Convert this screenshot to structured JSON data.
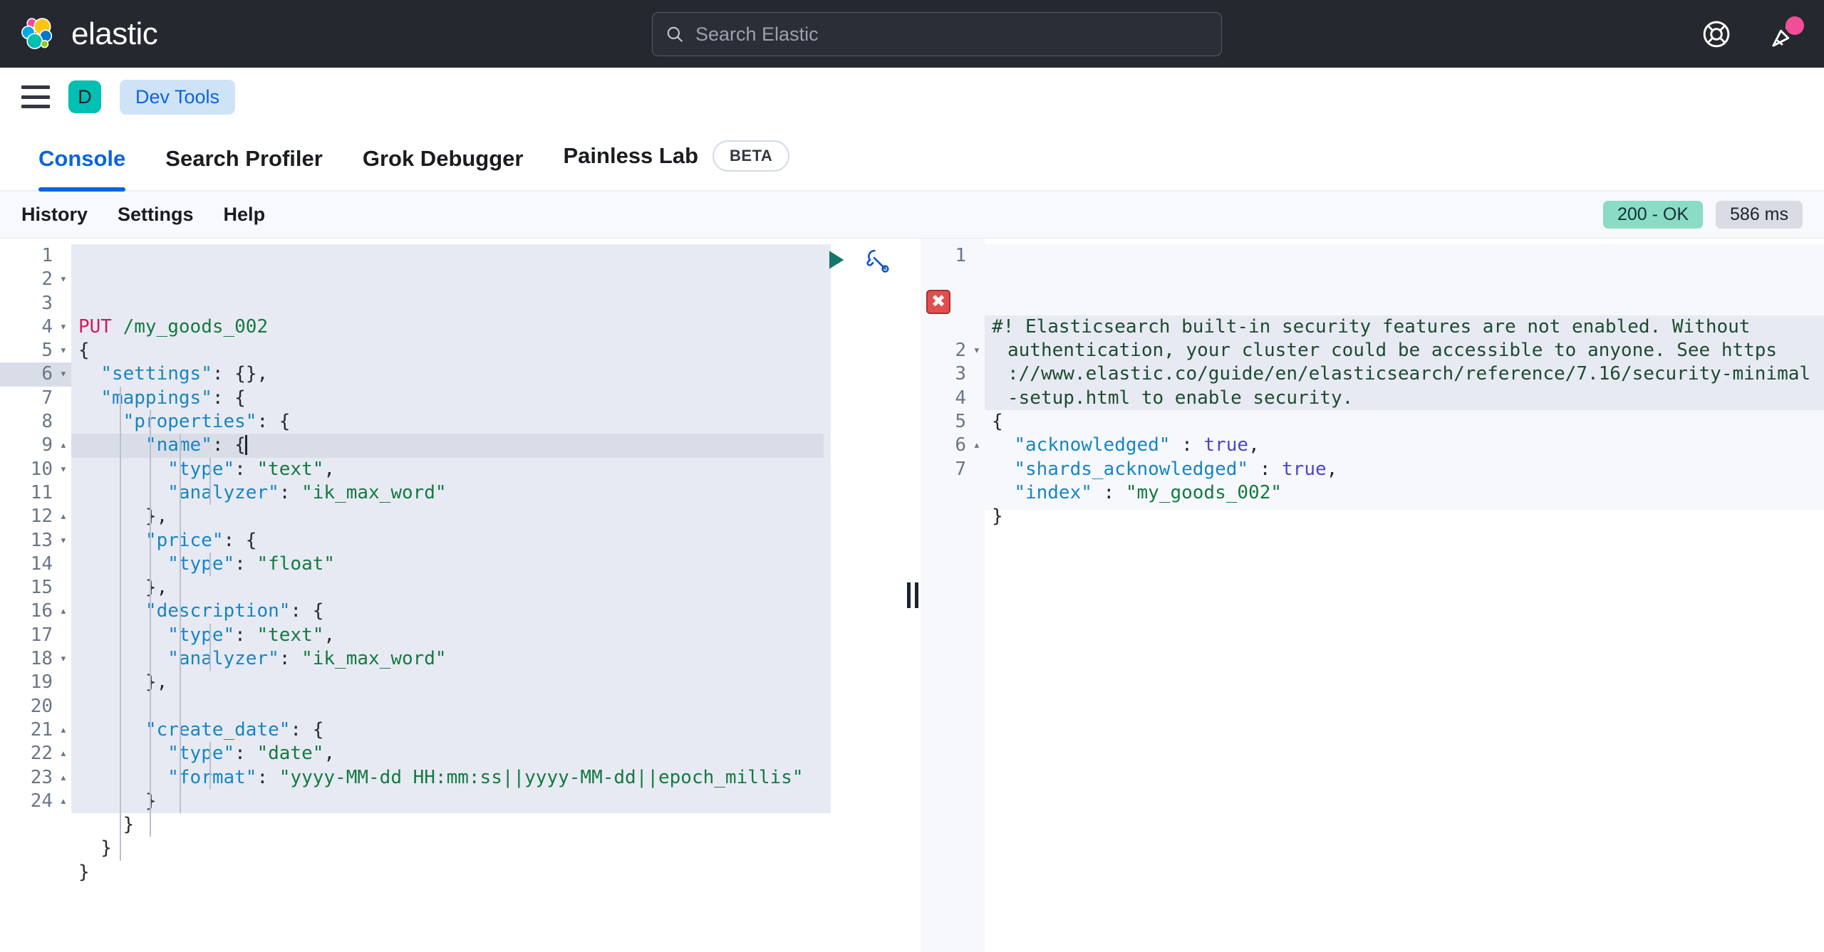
{
  "header": {
    "brand_name": "elastic",
    "logo_icon": "elastic-logo",
    "search": {
      "placeholder": "Search Elastic",
      "value": "",
      "icon": "search-icon"
    },
    "help_icon": "life-ring-help-icon",
    "announcements_icon": "party-popper-announcements-icon",
    "has_notification_dot": true,
    "notification_color": "#f04e98"
  },
  "breadcrumb": {
    "menu_icon": "hamburger-menu-icon",
    "space_initial": "D",
    "space_color": "#00bfb3",
    "crumb_label": "Dev Tools",
    "crumb_color": "#0b64dd"
  },
  "tabs": [
    {
      "label": "Console",
      "active": true,
      "badge": null
    },
    {
      "label": "Search Profiler",
      "active": false,
      "badge": null
    },
    {
      "label": "Grok Debugger",
      "active": false,
      "badge": null
    },
    {
      "label": "Painless Lab",
      "active": false,
      "badge": "BETA"
    }
  ],
  "console_toolbar": {
    "links": [
      "History",
      "Settings",
      "Help"
    ],
    "status_code": "200 - OK",
    "status_color": "#8bdcc4",
    "duration": "586 ms",
    "duration_color": "#d9dce4"
  },
  "request_editor": {
    "run_icon": "play-send-request-icon",
    "wrench_icon": "wrench-actions-icon",
    "active_line": 6,
    "total_lines": 24,
    "lines": [
      {
        "n": 1,
        "fold": "",
        "text": "PUT /my_goods_002"
      },
      {
        "n": 2,
        "fold": "▾",
        "text": "{"
      },
      {
        "n": 3,
        "fold": "",
        "text": "  \"settings\": {},"
      },
      {
        "n": 4,
        "fold": "▾",
        "text": "  \"mappings\": {"
      },
      {
        "n": 5,
        "fold": "▾",
        "text": "    \"properties\": {"
      },
      {
        "n": 6,
        "fold": "▾",
        "text": "      \"name\": {"
      },
      {
        "n": 7,
        "fold": "",
        "text": "        \"type\": \"text\","
      },
      {
        "n": 8,
        "fold": "",
        "text": "        \"analyzer\": \"ik_max_word\""
      },
      {
        "n": 9,
        "fold": "▴",
        "text": "      },"
      },
      {
        "n": 10,
        "fold": "▾",
        "text": "      \"price\": {"
      },
      {
        "n": 11,
        "fold": "",
        "text": "        \"type\": \"float\""
      },
      {
        "n": 12,
        "fold": "▴",
        "text": "      },"
      },
      {
        "n": 13,
        "fold": "▾",
        "text": "      \"description\": {"
      },
      {
        "n": 14,
        "fold": "",
        "text": "        \"type\": \"text\","
      },
      {
        "n": 15,
        "fold": "",
        "text": "        \"analyzer\": \"ik_max_word\""
      },
      {
        "n": 16,
        "fold": "▴",
        "text": "      },"
      },
      {
        "n": 17,
        "fold": "",
        "text": ""
      },
      {
        "n": 18,
        "fold": "▾",
        "text": "      \"create_date\": {"
      },
      {
        "n": 19,
        "fold": "",
        "text": "        \"type\": \"date\","
      },
      {
        "n": 20,
        "fold": "",
        "text": "        \"format\": \"yyyy-MM-dd HH:mm:ss||yyyy-MM-dd||epoch_millis\""
      },
      {
        "n": 21,
        "fold": "▴",
        "text": "      }"
      },
      {
        "n": 22,
        "fold": "▴",
        "text": "    }"
      },
      {
        "n": 23,
        "fold": "▴",
        "text": "  }"
      },
      {
        "n": 24,
        "fold": "▴",
        "text": "}"
      }
    ]
  },
  "splitter": {
    "icon": "vertical-resize-grip-icon"
  },
  "response_editor": {
    "error_marker_icon": "error-cross-icon",
    "total_lines": 7,
    "warning_text": "#! Elasticsearch built-in security features are not enabled. Without authentication, your cluster could be accessible to anyone. See https://www.elastic.co/guide/en/elasticsearch/reference/7.16/security-minimal-setup.html to enable security.",
    "warning_wrapped": [
      "#! Elasticsearch built-in security features are not enabled. Without",
      "authentication, your cluster could be accessible to anyone. See https",
      "://www.elastic.co/guide/en/elasticsearch/reference/7.16/security-minimal",
      "-setup.html to enable security."
    ],
    "lines": [
      {
        "n": 1,
        "fold": ""
      },
      {
        "n": 2,
        "fold": "▾",
        "text": "{"
      },
      {
        "n": 3,
        "fold": "",
        "text": "  \"acknowledged\" : true,"
      },
      {
        "n": 4,
        "fold": "",
        "text": "  \"shards_acknowledged\" : true,"
      },
      {
        "n": 5,
        "fold": "",
        "text": "  \"index\" : \"my_goods_002\""
      },
      {
        "n": 6,
        "fold": "▴",
        "text": "}"
      },
      {
        "n": 7,
        "fold": "",
        "text": ""
      }
    ],
    "body": {
      "acknowledged": "true",
      "shards_acknowledged": "true",
      "index": "my_goods_002"
    }
  }
}
